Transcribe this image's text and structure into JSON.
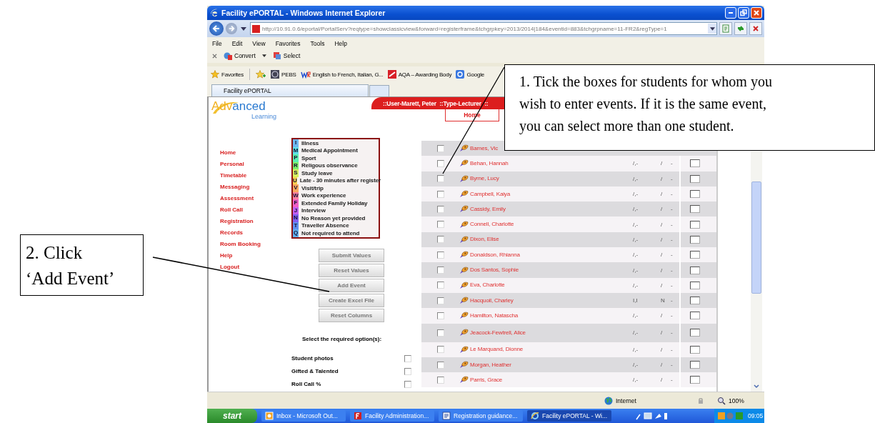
{
  "window": {
    "title": "Facility ePORTAL - Windows Internet Explorer"
  },
  "address_bar": {
    "url": "http://10.91.0.6/eportal/PortalServ?reqtype=showclassicview&forward=registerframe&tchgrpkey=2013/2014|184&eventid=883&tchgrpname=11-FR2&regType=1"
  },
  "menu": [
    "File",
    "Edit",
    "View",
    "Favorites",
    "Tools",
    "Help"
  ],
  "command_bar": [
    "Convert",
    "Select"
  ],
  "favorites_bar": {
    "label": "Favorites",
    "links": [
      {
        "label": "PEBS",
        "kind": "globe"
      },
      {
        "label": "English to French, Italian, G...",
        "kind": "wr"
      },
      {
        "label": "AQA – Awarding Body",
        "kind": "aqa"
      },
      {
        "label": "Google",
        "kind": "google"
      }
    ]
  },
  "tabs": [
    {
      "label": "Facility ePORTAL",
      "selected": true
    }
  ],
  "logo": {
    "part_1": "Adv",
    "part_2": "anced",
    "subtitle": "Learning"
  },
  "user_bar": "::User-Marett, Peter  ::Type-Lecturer  ::",
  "nav_tabs": [
    "Home"
  ],
  "sidebar": [
    "Home",
    "Personal",
    "Timetable",
    "Messaging",
    "Assessment",
    "Roll Call",
    "Registration",
    "Records",
    "Room Booking",
    "Help",
    "Logout"
  ],
  "legend": [
    {
      "code": "I",
      "label": "Illness",
      "color": "#6fb7f0"
    },
    {
      "code": "M",
      "label": "Medical Appointment",
      "color": "#5fe0e8"
    },
    {
      "code": "P",
      "label": "Sport",
      "color": "#5cf0b0"
    },
    {
      "code": "R",
      "label": "Religous observance",
      "color": "#7ef06a"
    },
    {
      "code": "S",
      "label": "Study leave",
      "color": "#d8f060"
    },
    {
      "code": "U",
      "label": "Late - 30 minutes after register",
      "color": "#f8d050"
    },
    {
      "code": "V",
      "label": "Visit/trip",
      "color": "#f8a860"
    },
    {
      "code": "W",
      "label": "Work experience",
      "color": "#f880a0"
    },
    {
      "code": "F",
      "label": "Extended Family Holiday",
      "color": "#f060c8"
    },
    {
      "code": "J",
      "label": "Interview",
      "color": "#c060f0"
    },
    {
      "code": "N",
      "label": "No Reason yet provided",
      "color": "#8060f0"
    },
    {
      "code": "T",
      "label": "Traveller Absence",
      "color": "#6090f0"
    },
    {
      "code": "Q",
      "label": "Not required to attend",
      "color": "#60b0f0"
    }
  ],
  "buttons": [
    "Submit Values",
    "Reset Values",
    "Add Event",
    "Create Excel File",
    "Reset Columns"
  ],
  "options_heading": "Select the required option(s):",
  "options": [
    {
      "label": "Student photos",
      "checked": false
    },
    {
      "label": "Gifted & Talented",
      "checked": false
    },
    {
      "label": "Roll Call %",
      "checked": false
    }
  ],
  "students": [
    {
      "name": "Barnes, Vic",
      "checked": false
    },
    {
      "name": "Behan, Hannah",
      "checked": false,
      "codes": [
        "/,-",
        "/",
        "-"
      ]
    },
    {
      "name": "Byrne, Lucy",
      "checked": false,
      "codes": [
        "/,-",
        "/",
        "-"
      ]
    },
    {
      "name": "Campbell, Kaiya",
      "checked": false,
      "codes": [
        "/,-",
        "/",
        "-"
      ]
    },
    {
      "name": "Cassidy, Emily",
      "checked": false,
      "codes": [
        "/,-",
        "/",
        "-"
      ]
    },
    {
      "name": "Connell, Charlotte",
      "checked": false,
      "codes": [
        "/,-",
        "/",
        "-"
      ]
    },
    {
      "name": "Dixon, Elise",
      "checked": false,
      "codes": [
        "/,-",
        "/",
        "-"
      ]
    },
    {
      "name": "Donaldson, Rhianna",
      "checked": false,
      "codes": [
        "/,-",
        "/",
        "-"
      ]
    },
    {
      "name": "Dos Santos, Sophie",
      "checked": false,
      "codes": [
        "/,-",
        "/",
        "-"
      ]
    },
    {
      "name": "Eva, Charlotte",
      "checked": false,
      "codes": [
        "/,-",
        "/",
        "-"
      ]
    },
    {
      "name": "Hacquoil, Charley",
      "checked": false,
      "codes": [
        "I,I",
        "N",
        "-"
      ]
    },
    {
      "name": "Hamilton, Natascha",
      "checked": false,
      "codes": [
        "/,-",
        "/",
        "-"
      ]
    },
    {
      "name": "Jeacock-Fewtrell, Alice",
      "checked": false,
      "codes": [
        "/,-",
        "/",
        "-"
      ]
    },
    {
      "name": "Le Marquand, Dionne",
      "checked": false,
      "codes": [
        "/,-",
        "/",
        "-"
      ]
    },
    {
      "name": "Morgan, Heather",
      "checked": false,
      "codes": [
        "/,-",
        "/",
        "-"
      ]
    },
    {
      "name": "Parris, Grace",
      "checked": false,
      "codes": [
        "/,-",
        "/",
        "-"
      ]
    }
  ],
  "status_bar": {
    "zone": "Internet",
    "zoom": "100%"
  },
  "taskbar": {
    "start": "start",
    "tasks": [
      {
        "label": "Inbox - Microsoft Out...",
        "kind": "mail",
        "selected": false
      },
      {
        "label": "Facility Administration...",
        "kind": "app",
        "selected": false
      },
      {
        "label": "Registration guidance...",
        "kind": "document",
        "selected": false
      },
      {
        "label": "Facility ePORTAL - Wi...",
        "kind": "browser",
        "selected": true
      }
    ],
    "clock": "09:05"
  },
  "callouts": [
    {
      "lines": [
        "1. Tick the boxes for students for whom you",
        "wish to enter events. If it is the same event,",
        "you can select more than one student."
      ]
    },
    {
      "lines": [
        "2. Click",
        "‘Add Event’"
      ]
    }
  ]
}
